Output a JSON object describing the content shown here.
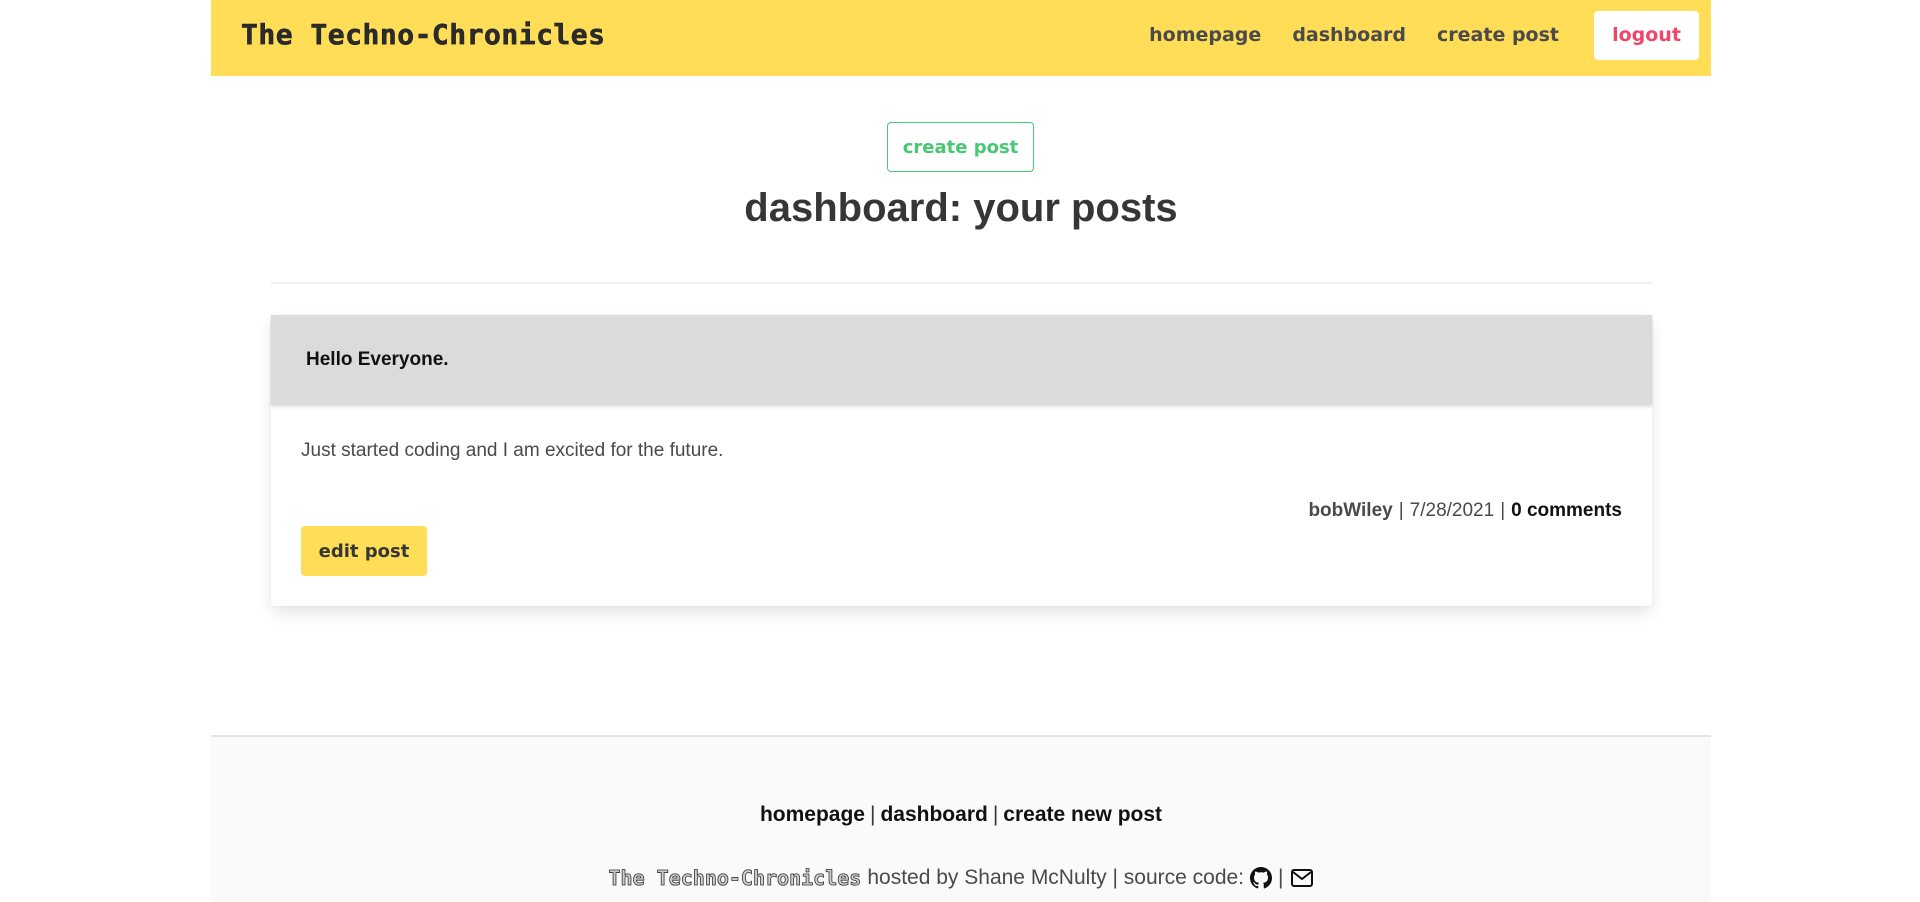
{
  "navbar": {
    "brand": "The Techno-Chronicles",
    "links": [
      "homepage",
      "dashboard",
      "create post"
    ],
    "logout_label": "logout"
  },
  "main": {
    "create_post_label": "create post",
    "title": "dashboard: your posts"
  },
  "post": {
    "title": "Hello Everyone.",
    "body": "Just started coding and I am excited for the future.",
    "author": "bobWiley",
    "separator": "|",
    "date": "7/28/2021",
    "comments": "0 comments",
    "edit_label": "edit post"
  },
  "footer": {
    "links": [
      "homepage",
      "dashboard",
      "create new post"
    ],
    "separator": "|",
    "brand": "The Techno-Chronicles",
    "credit": "hosted by Shane McNulty | source code:",
    "icons": [
      "github-icon",
      "envelope-icon"
    ]
  },
  "colors": {
    "navbar_bg": "#ffdd57",
    "logout_text": "#f14668",
    "create_post_accent": "#48c774",
    "card_header_bg": "#dbdbdb",
    "footer_bg": "#fafafa"
  }
}
